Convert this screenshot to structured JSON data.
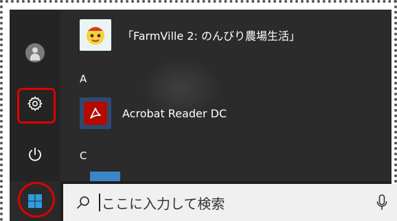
{
  "start_menu": {
    "apps": [
      {
        "name": "「FarmVille 2: のんびり農場生活」",
        "icon": "farmville-icon"
      },
      {
        "name": "Acrobat Reader DC",
        "icon": "acrobat-icon"
      }
    ],
    "groups": [
      "A",
      "C"
    ]
  },
  "taskbar": {
    "search_placeholder": "ここに入力して検索"
  },
  "colors": {
    "menu_bg": "#2b2b2b",
    "rail_bg": "#242424",
    "annotation": "#e00000",
    "search_bg": "#f0f0f0"
  }
}
